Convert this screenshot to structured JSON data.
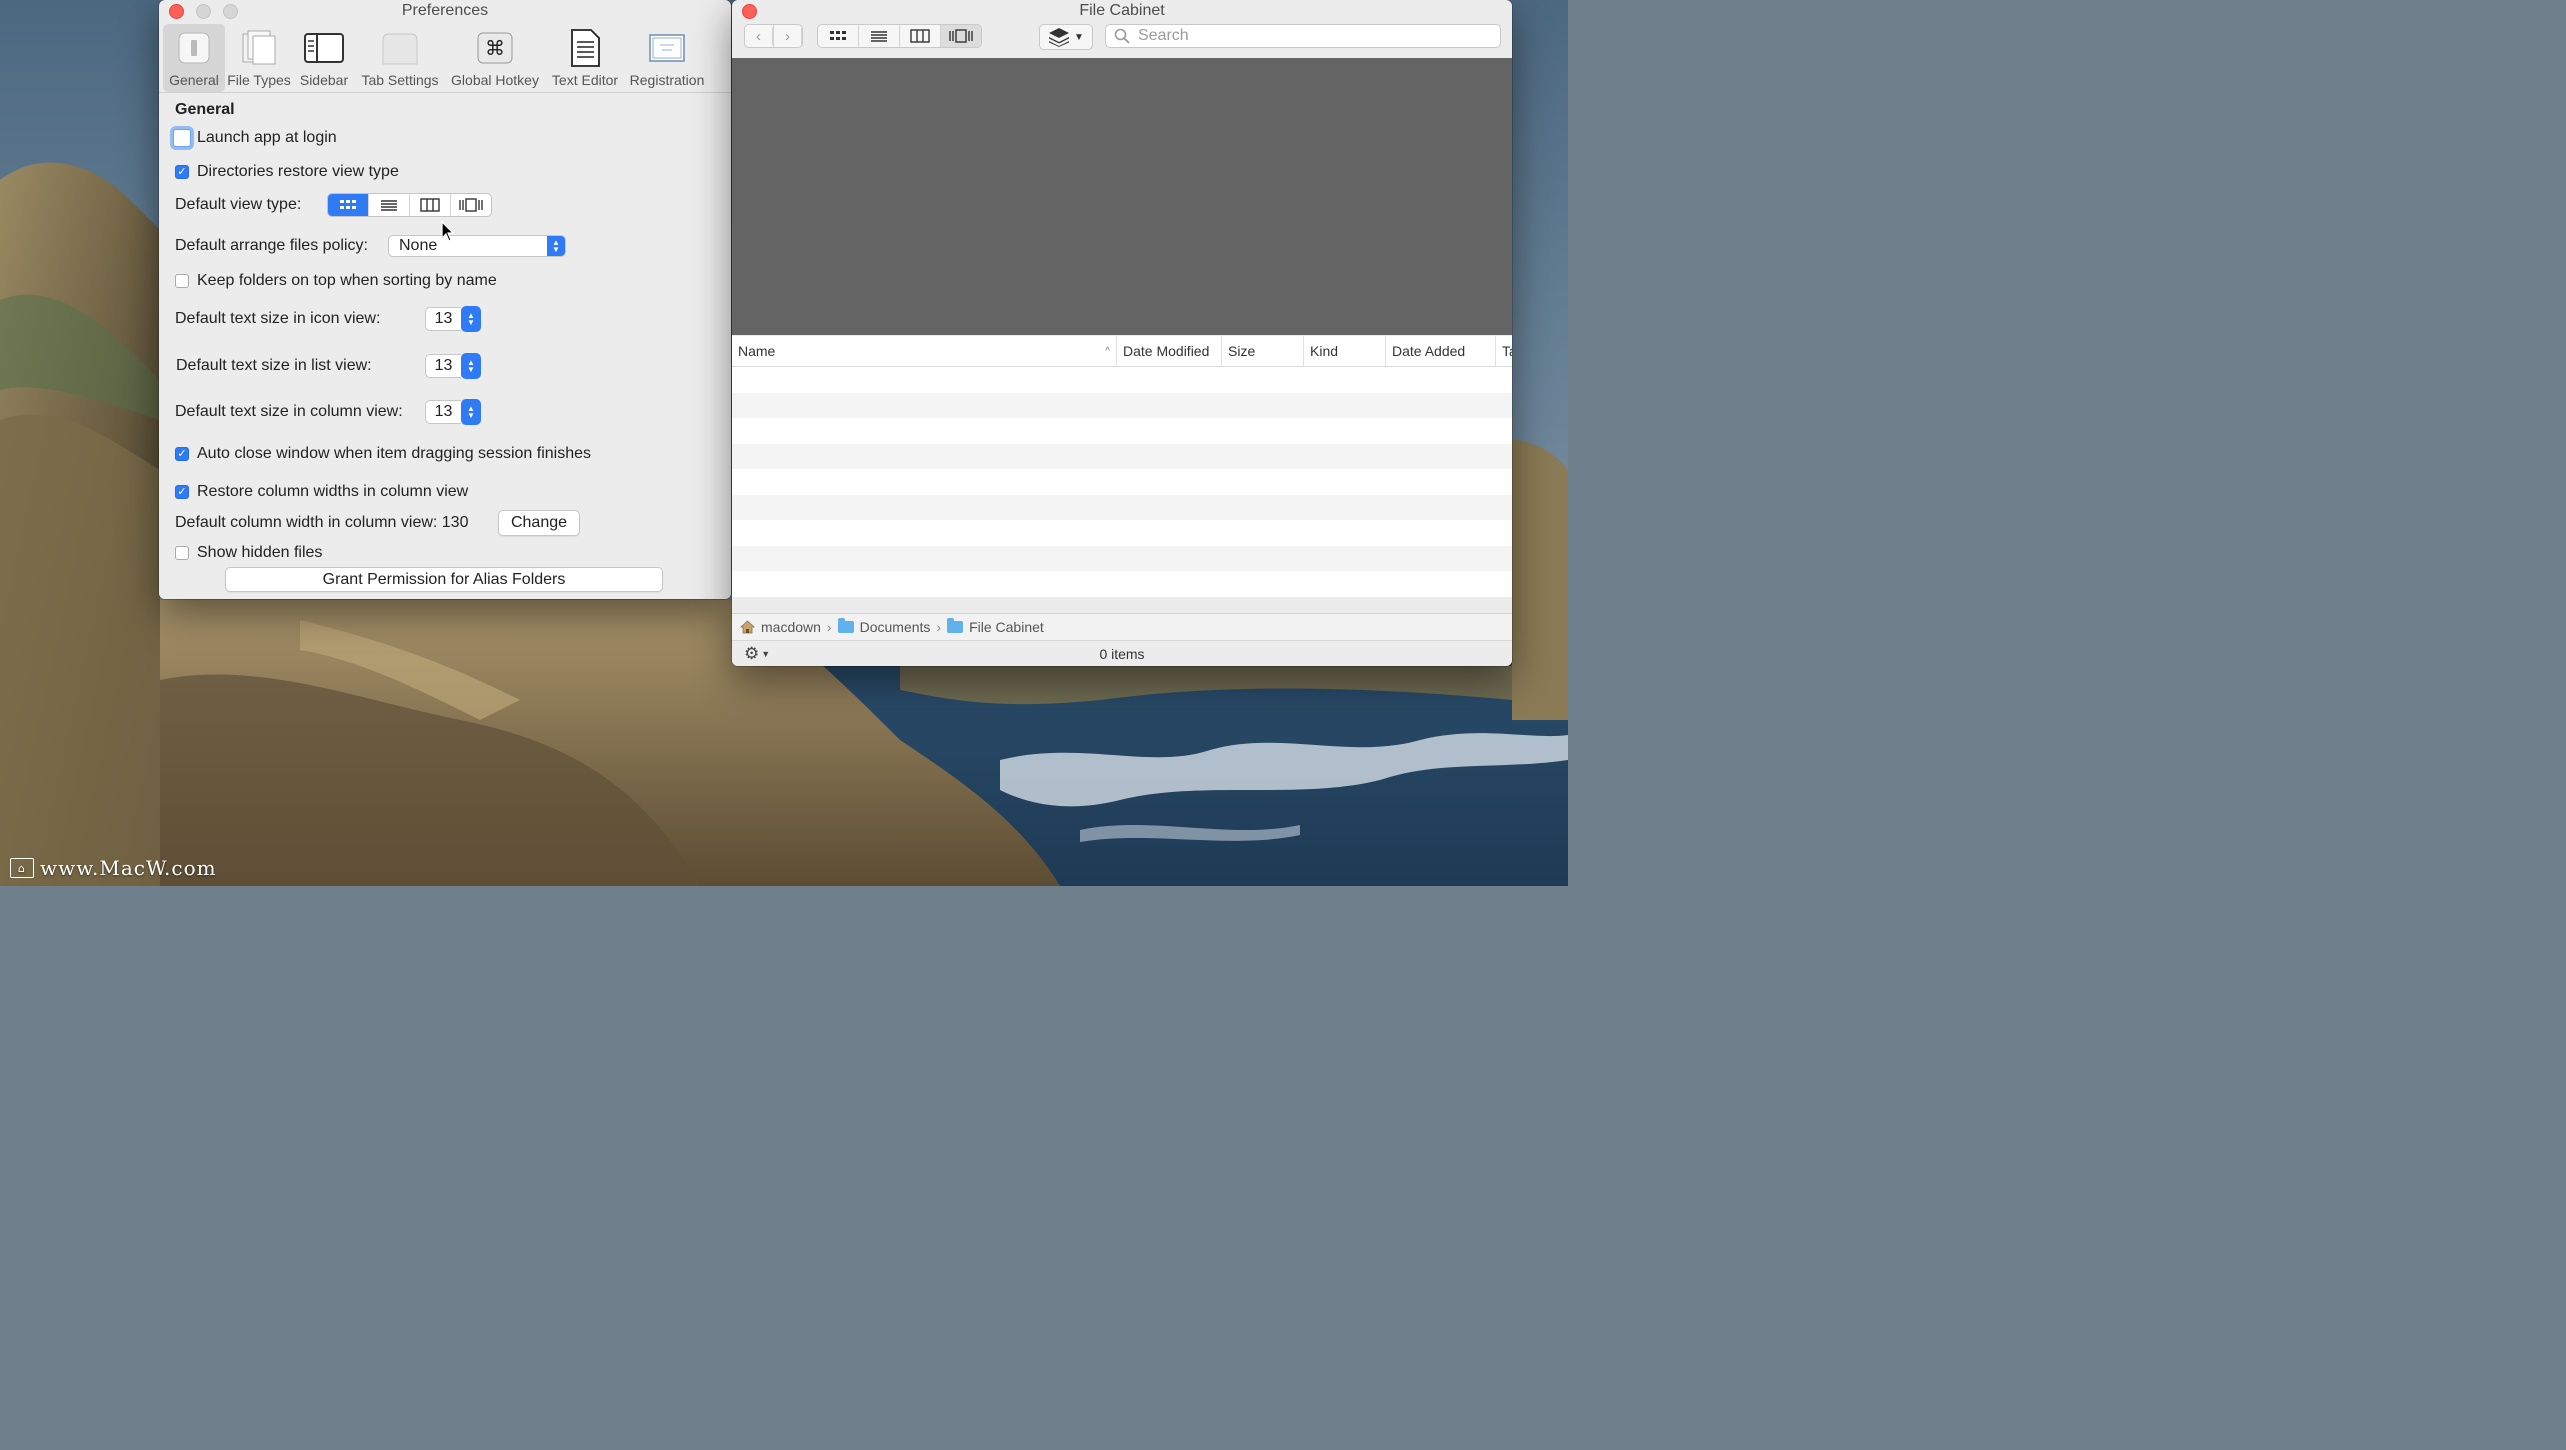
{
  "desktop": {
    "watermark": "www.MacW.com"
  },
  "preferences": {
    "title": "Preferences",
    "tabs": [
      {
        "label": "General",
        "icon": "general-icon",
        "active": true
      },
      {
        "label": "File Types",
        "icon": "file-types-icon"
      },
      {
        "label": "Sidebar",
        "icon": "sidebar-icon"
      },
      {
        "label": "Tab Settings",
        "icon": "tab-settings-icon"
      },
      {
        "label": "Global Hotkey",
        "icon": "command-key-icon"
      },
      {
        "label": "Text Editor",
        "icon": "text-editor-icon"
      },
      {
        "label": "Registration",
        "icon": "registration-icon"
      }
    ],
    "section_title": "General",
    "launch_at_login": {
      "label": "Launch app at login",
      "checked": false
    },
    "restore_view_type": {
      "label": "Directories restore view type",
      "checked": true
    },
    "default_view_type": {
      "label": "Default view type:",
      "selected": "icon"
    },
    "arrange_policy": {
      "label": "Default arrange files policy:",
      "value": "None"
    },
    "folders_on_top": {
      "label": "Keep folders on top when sorting by name",
      "checked": false
    },
    "text_size_icon": {
      "label": "Default text size in icon view:",
      "value": "13"
    },
    "text_size_list": {
      "label": "Default text size in list view:",
      "value": "13"
    },
    "text_size_column": {
      "label": "Default text size in column view:",
      "value": "13"
    },
    "auto_close": {
      "label": "Auto close window when item dragging session finishes",
      "checked": true
    },
    "restore_column_widths": {
      "label": "Restore column widths in column view",
      "checked": true
    },
    "column_width": {
      "label": "Default column width in column view: 130",
      "button": "Change"
    },
    "show_hidden": {
      "label": "Show hidden files",
      "checked": false
    },
    "grant_button": "Grant Permission for Alias Folders"
  },
  "cabinet": {
    "title": "File Cabinet",
    "search_placeholder": "Search",
    "columns": [
      "Name",
      "Date Modified",
      "Size",
      "Kind",
      "Date Added",
      "Ta"
    ],
    "path": [
      "macdown",
      "Documents",
      "File Cabinet"
    ],
    "status": "0 items"
  },
  "colors": {
    "accent": "#2f7bf5",
    "close": "#fe5f57",
    "preview_bg": "#646464"
  }
}
